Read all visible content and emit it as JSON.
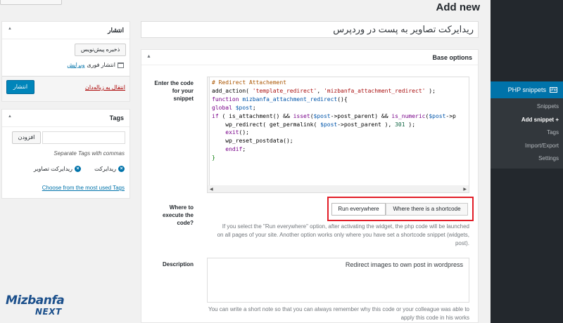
{
  "header": {
    "title": "Add new"
  },
  "post_title": "ریدایرکت تصاویر به پست در وردپرس",
  "admin_menu": {
    "active_item": "PHP snippets",
    "plugin_icon": "php-icon",
    "submenu": [
      "Snippets",
      "Add snippet +",
      "Tags",
      "Import/Export",
      "Settings"
    ],
    "current_submenu": "Add snippet +"
  },
  "base_options": {
    "title": "Base options",
    "code_label": "Enter the code for your snippet",
    "code_lines": [
      "# Redirect Attachement",
      "add_action( 'template_redirect', 'mizbanfa_attachment_redirect' );",
      "function mizbanfa_attachment_redirect(){",
      "global $post;",
      "if ( is_attachment() && isset($post->post_parent) && is_numeric($post->p",
      "    wp_redirect( get_permalink( $post->post_parent ), 301 );",
      "    exit();",
      "    wp_reset_postdata();",
      "    endif;",
      "}"
    ],
    "where_label": "Where to execute the code?",
    "scope_everywhere": "Run everywhere",
    "scope_shortcode": "Where there is a shortcode",
    "scope_help": "If you select the \"Run everywhere\" option, after activating the widget, the php code will be launched on all pages of your site. Another option works only where you have set a shortcode snippet (widgets, post).",
    "description_label": "Description",
    "description_value": "Redirect images to own post in wordpress",
    "description_help": "You can write a short note so that you can always remember why this code or your colleague was able to apply this code in his works"
  },
  "publish": {
    "title": "انتشار",
    "save_draft": "ذخیره پیش‌نویس",
    "status_text": "انتشار فوری",
    "edit_link": "ویرایش",
    "trash_link": "انتقال به زباله‌دان",
    "publish_button": "انتشار"
  },
  "tags": {
    "title": "Tags",
    "add_button": "افزودن",
    "help": "Separate Tags with commas",
    "items": [
      "ریدایرکت",
      "ریدایرکت تصاویر"
    ],
    "most_used_link": "Choose from the most used Tags"
  },
  "watermark": {
    "brand": "Mizbanfa",
    "sub": "NEXT"
  },
  "colors": {
    "admin_bar": "#23282d",
    "accent": "#0073aa",
    "highlight": "#e21d27"
  }
}
